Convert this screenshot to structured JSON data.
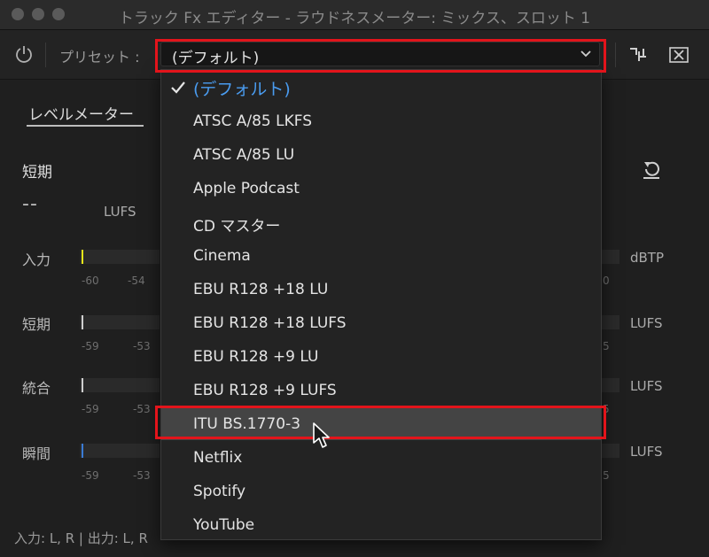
{
  "window": {
    "title": "トラック Fx エディター - ラウドネスメーター: ミックス、スロット 1"
  },
  "toolbar": {
    "preset_label": "プリセット :",
    "preset_value": "(デフォルト)"
  },
  "tabs": [
    {
      "label": "レベルメーター"
    }
  ],
  "meter": {
    "heading": "短期",
    "value": "--",
    "unit": "LUFS",
    "rows": [
      {
        "label": "入力",
        "unit": "dBTP",
        "ticks": [
          "-60",
          "-54"
        ],
        "right_tick": "0",
        "mark_color": "#e6e61a"
      },
      {
        "label": "短期",
        "unit": "LUFS",
        "ticks": [
          "-59",
          "-53"
        ],
        "right_tick": "5",
        "mark_color": "#cfcfcf"
      },
      {
        "label": "統合",
        "unit": "LUFS",
        "ticks": [
          "-59",
          "-53"
        ],
        "right_tick": "5",
        "mark_color": "#cfcfcf"
      },
      {
        "label": "瞬間",
        "unit": "LUFS",
        "ticks": [
          "-59",
          "-53"
        ],
        "right_tick": "5",
        "mark_color": "#3a7bd5"
      }
    ]
  },
  "footer": {
    "text": "入力: L, R | 出力: L, R"
  },
  "dropdown": {
    "items": [
      {
        "label": "(デフォルト)",
        "selected": true
      },
      {
        "label": "ATSC A/85 LKFS"
      },
      {
        "label": "ATSC A/85 LU"
      },
      {
        "label": "Apple Podcast"
      },
      {
        "label": "CD マスター"
      },
      {
        "label": "Cinema"
      },
      {
        "label": "EBU R128 +18 LU"
      },
      {
        "label": "EBU R128 +18 LUFS"
      },
      {
        "label": "EBU R128 +9 LU"
      },
      {
        "label": "EBU R128 +9 LUFS"
      },
      {
        "label": "ITU BS.1770-3",
        "hover": true
      },
      {
        "label": "Netflix"
      },
      {
        "label": "Spotify"
      },
      {
        "label": "YouTube"
      }
    ]
  },
  "colors": {
    "highlight": "#e3141b",
    "selected_text": "#4a9cf0"
  },
  "icons": [
    "power-icon",
    "chevron-down-icon",
    "routing-icon",
    "close-icon",
    "reset-icon",
    "checkmark-icon",
    "mouse-cursor-icon"
  ]
}
